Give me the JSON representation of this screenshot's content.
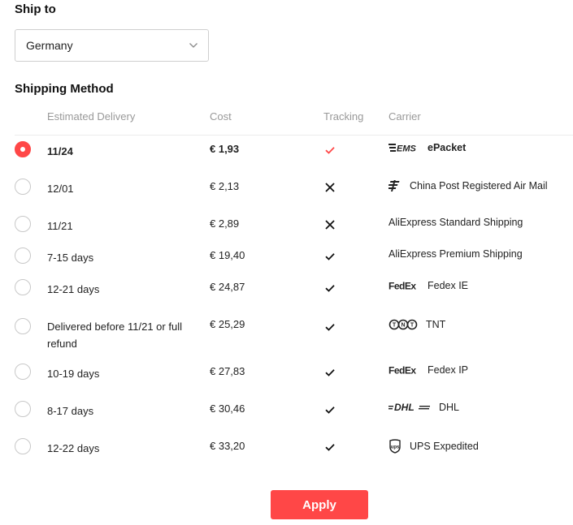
{
  "ship_to": {
    "title": "Ship to",
    "country": "Germany"
  },
  "shipping_method": {
    "title": "Shipping Method",
    "headers": {
      "delivery": "Estimated Delivery",
      "cost": "Cost",
      "tracking": "Tracking",
      "carrier": "Carrier"
    },
    "rows": [
      {
        "delivery": "11/24",
        "cost": "€ 1,93",
        "tracking": "check-red",
        "logo": "ems-logo",
        "carrier": "ePacket",
        "selected": true
      },
      {
        "delivery": "12/01",
        "cost": "€ 2,13",
        "tracking": "cross",
        "logo": "china-post-logo",
        "carrier": "China Post Registered Air Mail",
        "selected": false
      },
      {
        "delivery": "11/21",
        "cost": "€ 2,89",
        "tracking": "cross",
        "logo": "",
        "carrier": "AliExpress Standard Shipping",
        "selected": false
      },
      {
        "delivery": "7-15 days",
        "cost": "€ 19,40",
        "tracking": "check",
        "logo": "",
        "carrier": "AliExpress Premium Shipping",
        "selected": false
      },
      {
        "delivery": "12-21 days",
        "cost": "€ 24,87",
        "tracking": "check",
        "logo": "fedex-logo",
        "carrier": "Fedex IE",
        "selected": false
      },
      {
        "delivery": "Delivered before 11/21 or full refund",
        "cost": "€ 25,29",
        "tracking": "check",
        "logo": "tnt-logo",
        "carrier": "TNT",
        "selected": false
      },
      {
        "delivery": "10-19 days",
        "cost": "€ 27,83",
        "tracking": "check",
        "logo": "fedex-logo",
        "carrier": "Fedex IP",
        "selected": false
      },
      {
        "delivery": "8-17 days",
        "cost": "€ 30,46",
        "tracking": "check",
        "logo": "dhl-logo",
        "carrier": "DHL",
        "selected": false
      },
      {
        "delivery": "12-22 days",
        "cost": "€ 33,20",
        "tracking": "check",
        "logo": "ups-logo",
        "carrier": "UPS Expedited",
        "selected": false
      }
    ]
  },
  "apply_label": "Apply",
  "colors": {
    "accent": "#ff4747",
    "border": "#cfcfcf",
    "muted_text": "#999999"
  }
}
